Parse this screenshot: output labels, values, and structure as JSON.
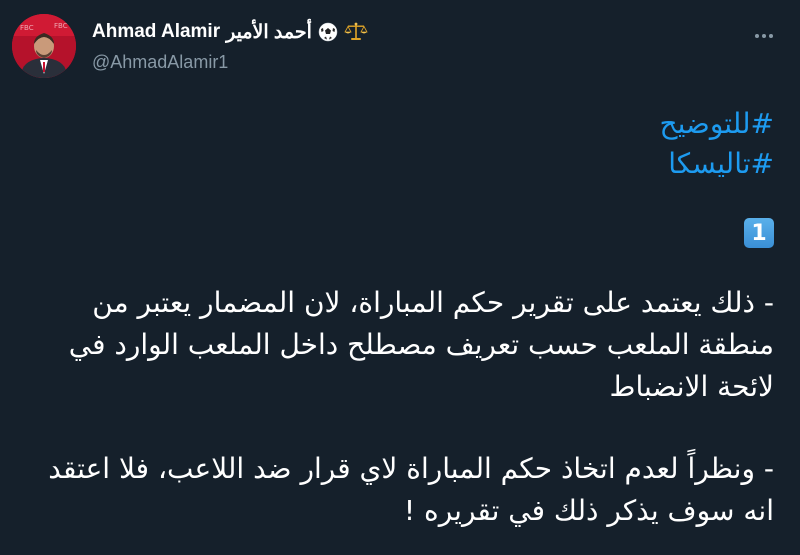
{
  "author": {
    "name": "Ahmad Alamir",
    "arabic_name": "أحمد الأمير",
    "handle": "@AhmadAlamir1",
    "emoji_icons": [
      "soccer-ball-icon",
      "balance-scale-icon"
    ]
  },
  "tweet": {
    "hashtags": [
      "#للتوضيح",
      "#تاليسكا"
    ],
    "number_emoji": "1",
    "paragraphs": [
      "- ذلك يعتمد على تقرير حكم المباراة، لان المضمار يعتبر من منطقة الملعب حسب تعريف مصطلح داخل الملعب الوارد في لائحة الانضباط",
      "- ونظراً لعدم اتخاذ حكم المباراة لاي قرار ضد اللاعب، فلا اعتقد انه سوف يذكر ذلك في تقريره !"
    ]
  },
  "colors": {
    "background": "#15202b",
    "text": "#ffffff",
    "secondary_text": "#8899a6",
    "hashtag": "#1d9bf0"
  }
}
